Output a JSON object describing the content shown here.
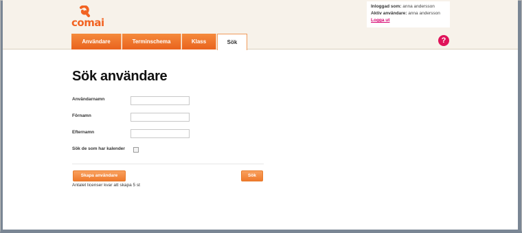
{
  "brand": {
    "logo_text": "comai",
    "accent": "#f26322",
    "tab_color": "#ef7a2c",
    "help_color": "#e0135a"
  },
  "login": {
    "logged_in_label": "Inloggad som:",
    "logged_in_user": "anna andersson",
    "active_user_label": "Aktiv användare:",
    "active_user": "anna andersson",
    "logout": "Logga ut"
  },
  "help": {
    "label": "?"
  },
  "tabs": [
    {
      "label": "Användare",
      "active": false
    },
    {
      "label": "Terminschema",
      "active": false
    },
    {
      "label": "Klass",
      "active": false
    },
    {
      "label": "Sök",
      "active": true
    }
  ],
  "page": {
    "title": "Sök användare"
  },
  "form": {
    "username_label": "Användarnamn",
    "username_value": "",
    "firstname_label": "Förnamn",
    "firstname_value": "",
    "lastname_label": "Efternamn",
    "lastname_value": "",
    "calendar_label": "Sök de som har kalender",
    "calendar_checked": false
  },
  "actions": {
    "create_label": "Skapa användare",
    "search_label": "Sök"
  },
  "license_info": "Antalet licenser kvar att skapa 5 st"
}
